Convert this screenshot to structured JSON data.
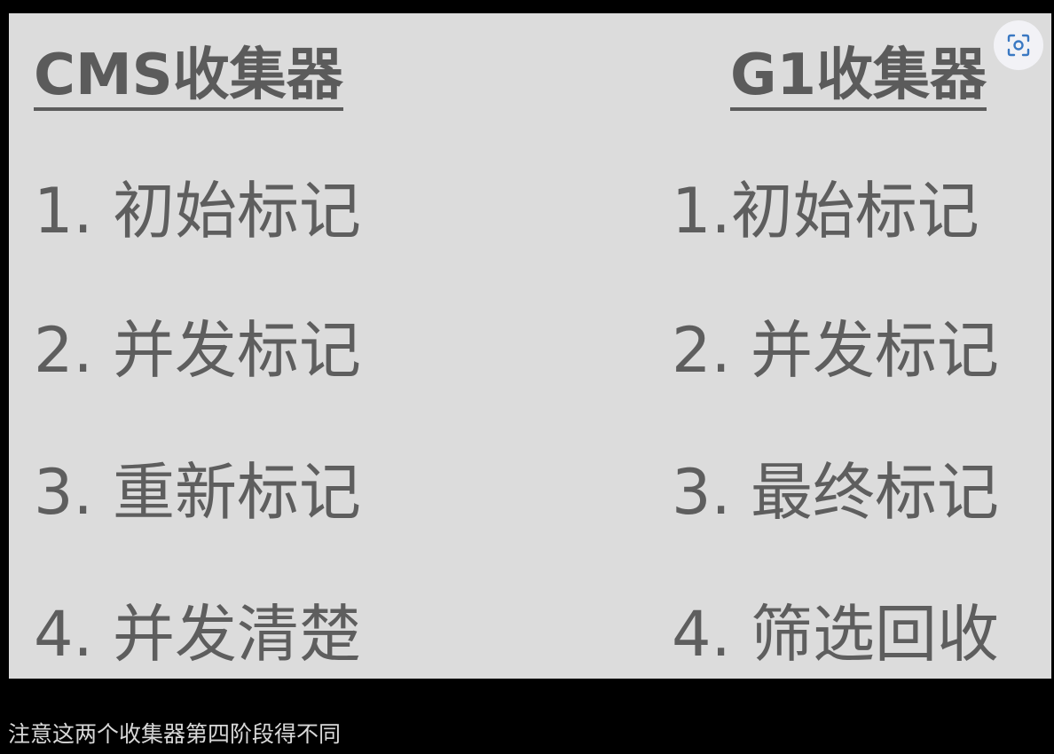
{
  "image": {
    "left_column": {
      "title": "CMS收集器",
      "items": [
        "1. 初始标记",
        "2. 并发标记",
        "3. 重新标记",
        "4. 并发清楚"
      ]
    },
    "right_column": {
      "title": "G1收集器",
      "items": [
        "1.初始标记",
        "2. 并发标记",
        "3. 最终标记",
        "4. 筛选回收"
      ]
    }
  },
  "lens_button": {
    "icon": "visual-search-icon",
    "icon_color": "#3a78c2"
  },
  "caption": "注意这两个收集器第四阶段得不同"
}
